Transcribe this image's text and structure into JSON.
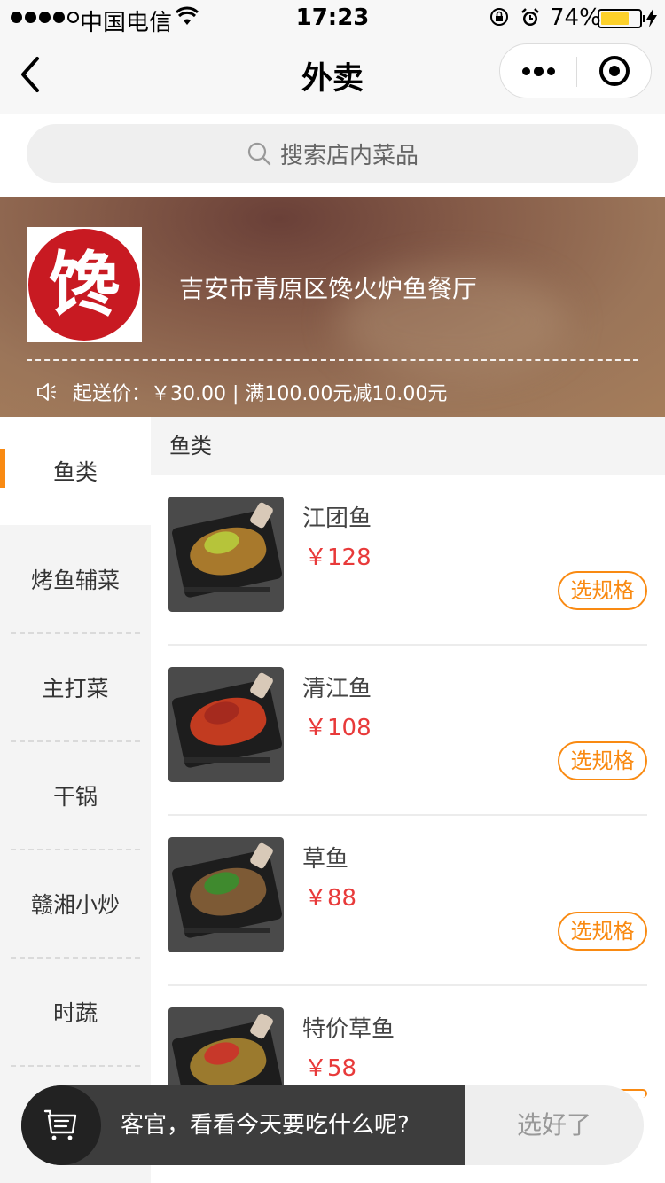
{
  "status_bar": {
    "carrier": "中国电信",
    "time": "17:23",
    "battery_percent": "74%",
    "battery_level": 0.74,
    "icons": [
      "signal-dots",
      "wifi-icon",
      "rotation-lock-icon",
      "alarm-icon",
      "battery-icon",
      "charging-icon"
    ]
  },
  "nav": {
    "title": "外卖",
    "icons": [
      "back-chevron-icon",
      "more-dots-icon",
      "close-target-icon"
    ]
  },
  "search": {
    "placeholder": "搜索店内菜品",
    "icon": "search-icon"
  },
  "shop": {
    "logo_text": "馋",
    "name": "吉安市青原区馋火炉鱼餐厅",
    "notice": "起送价：￥30.00 | 满100.00元减10.00元",
    "notice_icon": "speaker-icon"
  },
  "categories": [
    {
      "label": "鱼类",
      "active": true
    },
    {
      "label": "烤鱼辅菜",
      "active": false
    },
    {
      "label": "主打菜",
      "active": false
    },
    {
      "label": "干锅",
      "active": false
    },
    {
      "label": "赣湘小炒",
      "active": false
    },
    {
      "label": "时蔬",
      "active": false
    }
  ],
  "section": {
    "title": "鱼类"
  },
  "dishes": [
    {
      "name": "江团鱼",
      "price": "￥128",
      "button": "选规格"
    },
    {
      "name": "清江鱼",
      "price": "￥108",
      "button": "选规格"
    },
    {
      "name": "草鱼",
      "price": "￥88",
      "button": "选规格"
    },
    {
      "name": "特价草鱼",
      "price": "￥58",
      "button": ""
    }
  ],
  "cart": {
    "message": "客官，看看今天要吃什么呢?",
    "done_label": "选好了",
    "icon": "cart-icon"
  },
  "colors": {
    "accent": "#f98a12",
    "price": "#e83a3a",
    "logo_red": "#c81a22",
    "battery": "#fdd12a"
  }
}
